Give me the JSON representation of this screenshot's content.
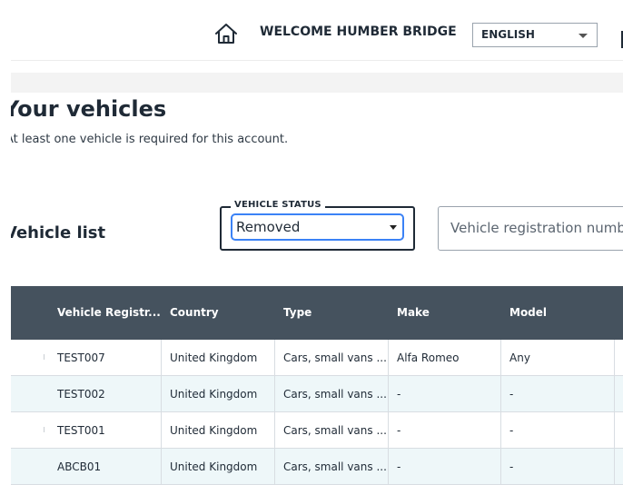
{
  "header": {
    "welcome": "WELCOME HUMBER BRIDGE",
    "language_value": "ENGLISH"
  },
  "icons": {
    "home": "home-icon",
    "dropdown": "chevron-down-icon"
  },
  "page": {
    "title": "Your vehicles",
    "subtitle": "At least one vehicle is required for this account."
  },
  "vehicle_list": {
    "title": "Vehicle list",
    "status_label": "VEHICLE STATUS",
    "status_value": "Removed",
    "search_placeholder": "Vehicle registration number"
  },
  "table": {
    "columns": [
      "Vehicle Registr...",
      "Country",
      "Type",
      "Make",
      "Model"
    ],
    "rows": [
      [
        "TEST007",
        "United Kingdom",
        "Cars, small vans ...",
        "Alfa Romeo",
        "Any"
      ],
      [
        "TEST002",
        "United Kingdom",
        "Cars, small vans ...",
        "-",
        "-"
      ],
      [
        "TEST001",
        "United Kingdom",
        "Cars, small vans ...",
        "-",
        "-"
      ],
      [
        "ABCB01",
        "United Kingdom",
        "Cars, small vans ...",
        "-",
        "-"
      ]
    ]
  },
  "colors": {
    "table_header": "#45525e",
    "row_alt": "#eef7f9",
    "focus": "#3b82f6",
    "text": "#1f2a36"
  }
}
